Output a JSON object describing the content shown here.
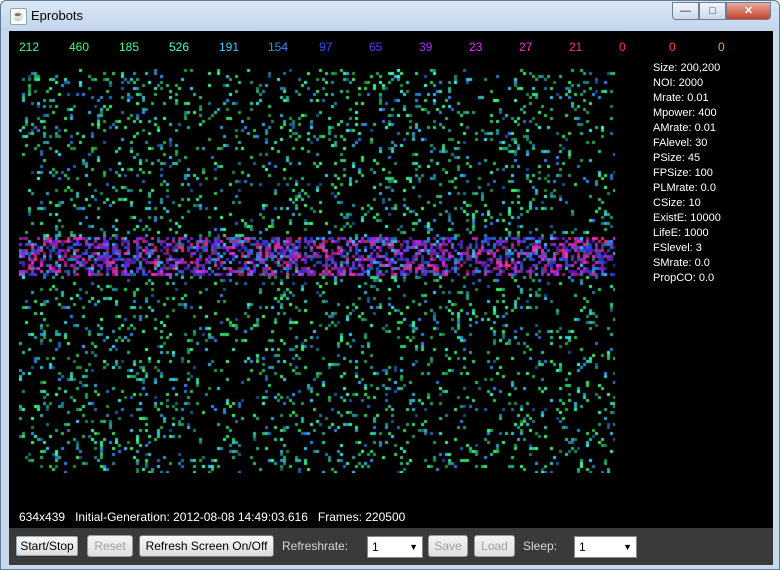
{
  "window": {
    "title": "Eprobots"
  },
  "counts": [
    {
      "value": "212",
      "color": "#3cff6e"
    },
    {
      "value": "460",
      "color": "#3cff6e"
    },
    {
      "value": "185",
      "color": "#3cff9a"
    },
    {
      "value": "526",
      "color": "#3cffd8"
    },
    {
      "value": "191",
      "color": "#3cc8ff"
    },
    {
      "value": "154",
      "color": "#2f8cff"
    },
    {
      "value": "97",
      "color": "#2f4cff"
    },
    {
      "value": "65",
      "color": "#6a2fff"
    },
    {
      "value": "39",
      "color": "#a52fff"
    },
    {
      "value": "23",
      "color": "#e02fff"
    },
    {
      "value": "27",
      "color": "#ff2fd0"
    },
    {
      "value": "21",
      "color": "#ff2f7a"
    },
    {
      "value": "0",
      "color": "#ff3030"
    },
    {
      "value": "0",
      "color": "#ff5030"
    },
    {
      "value": "0",
      "color": "#ffa030"
    }
  ],
  "parameters": [
    "Size: 200,200",
    "NOI: 2000",
    "Mrate: 0.01",
    "Mpower: 400",
    "AMrate: 0.01",
    "FAlevel: 30",
    "PSize: 45",
    "FPSize: 100",
    "PLMrate: 0.0",
    "CSize: 10",
    "ExistE: 10000",
    "LifeE: 1000",
    "FSlevel: 3",
    "SMrate: 0.0",
    "PropCO: 0.0"
  ],
  "status": {
    "dimensions": "634x439",
    "initial_generation": "Initial-Generation: 2012-08-08 14:49:03.616",
    "frames": "Frames: 220500"
  },
  "toolbar": {
    "start_stop": "Start/Stop",
    "reset": "Reset",
    "refresh_screen": "Refresh Screen On/Off",
    "refreshrate_label": "Refreshrate:",
    "refreshrate_value": "1",
    "save": "Save",
    "load": "Load",
    "sleep_label": "Sleep:",
    "sleep_value": "1"
  },
  "colors": {
    "canvas_bg": "#000000",
    "toolbar_bg": "#3a3a3a"
  }
}
